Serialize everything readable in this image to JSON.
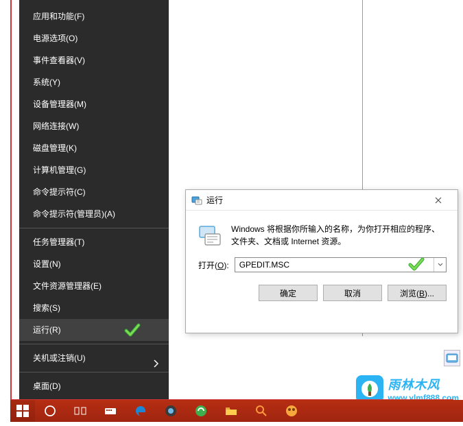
{
  "winx_menu": {
    "items": [
      {
        "label": "应用和功能(F)"
      },
      {
        "label": "电源选项(O)"
      },
      {
        "label": "事件查看器(V)"
      },
      {
        "label": "系统(Y)"
      },
      {
        "label": "设备管理器(M)"
      },
      {
        "label": "网络连接(W)"
      },
      {
        "label": "磁盘管理(K)"
      },
      {
        "label": "计算机管理(G)"
      },
      {
        "label": "命令提示符(C)"
      },
      {
        "label": "命令提示符(管理员)(A)"
      }
    ],
    "items2": [
      {
        "label": "任务管理器(T)"
      },
      {
        "label": "设置(N)"
      },
      {
        "label": "文件资源管理器(E)"
      },
      {
        "label": "搜索(S)"
      },
      {
        "label": "运行(R)",
        "highlighted": true
      }
    ],
    "items3": [
      {
        "label": "关机或注销(U)"
      }
    ],
    "items4": [
      {
        "label": "桌面(D)"
      }
    ]
  },
  "run_dialog": {
    "title": "运行",
    "description": "Windows 将根据你所输入的名称，为你打开相应的程序、文件夹、文档或 Internet 资源。",
    "open_label": "打开",
    "open_key": "O",
    "input_value": "GPEDIT.MSC",
    "ok": "确定",
    "cancel": "取消",
    "browse": "浏览",
    "browse_key": "B"
  },
  "watermark": {
    "title": "雨林木风",
    "url": "www.ylmf888.com"
  },
  "icons": {
    "run": "run-icon",
    "close": "close-icon",
    "check": "check-icon",
    "chevron_down": "chevron-down-icon"
  }
}
